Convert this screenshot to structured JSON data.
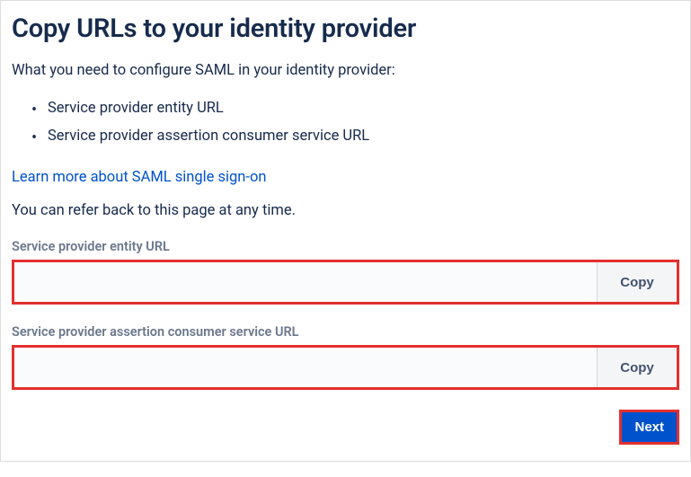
{
  "title": "Copy URLs to your identity provider",
  "intro": "What you need to configure SAML in your identity provider:",
  "bullets": [
    "Service provider entity URL",
    "Service provider assertion consumer service URL"
  ],
  "learn_more": "Learn more about SAML single sign-on",
  "refer_text": "You can refer back to this page at any time.",
  "fields": {
    "entity": {
      "label": "Service provider entity URL",
      "value": "",
      "copy_label": "Copy"
    },
    "acs": {
      "label": "Service provider assertion consumer service URL",
      "value": "",
      "copy_label": "Copy"
    }
  },
  "next_label": "Next"
}
